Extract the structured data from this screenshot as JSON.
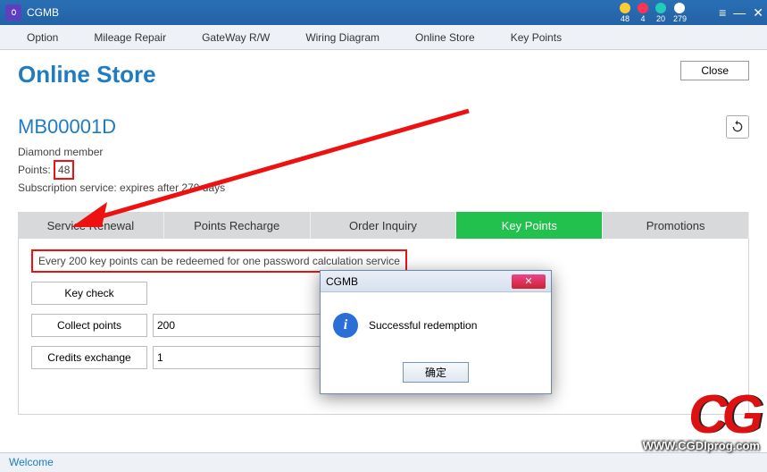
{
  "titlebar": {
    "app_name": "CGMB",
    "stats": [
      {
        "color": "#ffcc33",
        "value": "48",
        "name": "coin-icon"
      },
      {
        "color": "#ff3355",
        "value": "4",
        "name": "gem-icon"
      },
      {
        "color": "#22ccbb",
        "value": "20",
        "name": "gem-icon-2"
      },
      {
        "color": "#ffffff",
        "value": "279",
        "name": "calendar-icon"
      }
    ]
  },
  "menubar": {
    "items": [
      "Option",
      "Mileage Repair",
      "GateWay R/W",
      "Wiring Diagram",
      "Online Store",
      "Key Points"
    ]
  },
  "header": {
    "title": "Online Store",
    "close_label": "Close"
  },
  "account": {
    "id": "MB00001D",
    "member_level": "Diamond member",
    "points_label": "Points:",
    "points_value": "48",
    "subscription": "Subscription service: expires after 279 days"
  },
  "tabs": [
    "Service Renewal",
    "Points Recharge",
    "Order Inquiry",
    "Key Points",
    "Promotions"
  ],
  "active_tab_index": 3,
  "key_points": {
    "notice": "Every 200 key points can be redeemed for one password calculation service",
    "key_check_label": "Key check",
    "collect_points_label": "Collect points",
    "collect_points_value": "200",
    "credits_exchange_label": "Credits exchange",
    "credits_exchange_value": "1"
  },
  "dialog": {
    "title": "CGMB",
    "message": "Successful redemption",
    "ok_label": "确定"
  },
  "statusbar": {
    "text": "Welcome"
  },
  "watermark": {
    "url": "WWW.CGDIprog.com",
    "logo": "CG"
  }
}
